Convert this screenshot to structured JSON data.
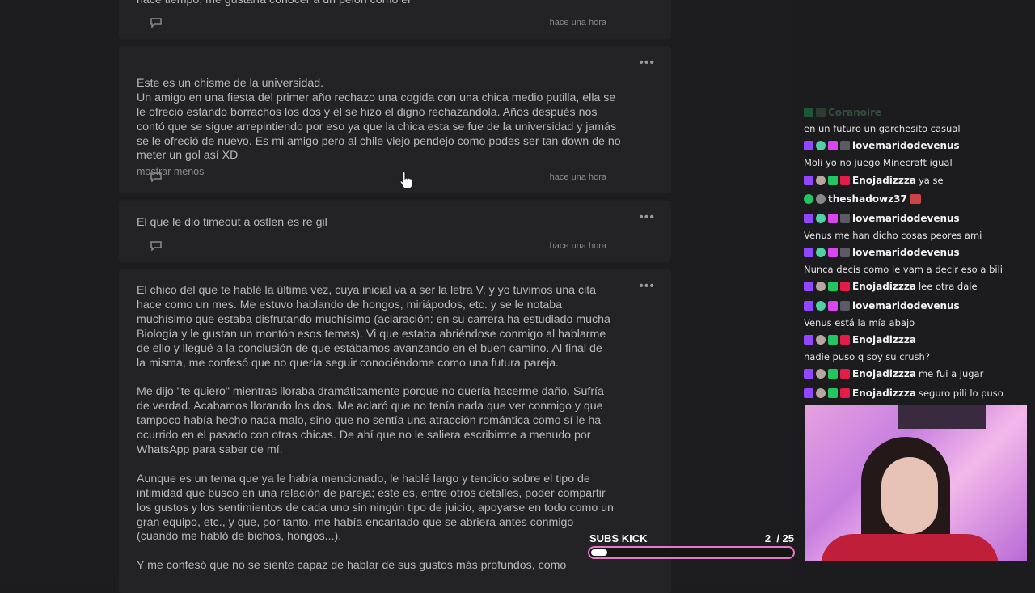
{
  "posts": [
    {
      "text": "hace tiempo, me gustaría conocer a un pelón como él",
      "time": "hace una hora"
    },
    {
      "text": "Este es un chisme de la universidad.\nUn amigo en una fiesta del primer año rechazo una cogida con una chica medio putilla, ella se le ofreció estando borrachos los dos y él se hizo el digno rechazandola. Años después nos contó que se sigue arrepintiendo por eso ya que la chica esta se fue de la universidad y jamás se le ofreció de nuevo. Es mi amigo pero al chile viejo pendejo como podes ser tan down de no meter un gol así XD",
      "toggle": "mostrar menos",
      "time": "hace una hora",
      "more": "•••"
    },
    {
      "text": "El que le dio timeout a ostlen es re gil",
      "time": "hace una hora",
      "more": "•••"
    },
    {
      "text": "El chico del que te hablé la última vez, cuya inicial va a ser la letra V, y yo tuvimos una cita hace como un mes. Me estuvo hablando de hongos, miriápodos, etc. y se le notaba muchísimo que estaba disfrutando muchísimo (aclaración: en su carrera ha estudiado mucha Biología y le gustan un montón esos temas). Vi que estaba abriéndose conmigo al hablarme de ello y llegué a la conclusión de que estábamos avanzando en el buen camino. Al final de la misma, me confesó que no quería seguir conociéndome como una futura pareja.\n\nMe dijo \"te quiero\" mientras lloraba dramáticamente porque no quería hacerme daño. Sufría de verdad. Acabamos llorando los dos. Me aclaró que no tenía nada que ver conmigo y que tampoco había hecho nada malo, sino que no sentía una atracción romántica como sí le ha ocurrido en el pasado con otras chicas. De ahí que no le saliera escribirme a menudo por WhatsApp para saber de mí.\n\nAunque es un tema que ya le había mencionado, le hablé largo y tendido sobre el tipo de intimidad que busco en una relación de pareja; este es, entre otros detalles, poder compartir los gustos y los sentimientos de cada uno sin ningún tipo de juicio, apoyarse en todo como un gran equipo, etc., y que, por tanto, me había encantado que se abriera antes conmigo (cuando me habló de bichos, hongos...).\n\nY me confesó que no se siente capaz de hablar de sus gustos más profundos, como",
      "more": "•••"
    }
  ],
  "chat": [
    {
      "user": "Coranoire",
      "msg": ""
    },
    {
      "user": "",
      "msg": "en un futuro un garchesito casual"
    },
    {
      "user": "lovemaridodevenus",
      "msg": ""
    },
    {
      "user": "",
      "msg": "Moli yo no juego Minecraft igual"
    },
    {
      "user": "Enojadizzza",
      "msg": "ya se"
    },
    {
      "user": "theshadowz37",
      "msg": ""
    },
    {
      "user": "lovemaridodevenus",
      "msg": ""
    },
    {
      "user": "",
      "msg": "Venus me han dicho cosas peores ami"
    },
    {
      "user": "lovemaridodevenus",
      "msg": ""
    },
    {
      "user": "",
      "msg": "Nunca decís como le vam a decir eso a bili"
    },
    {
      "user": "Enojadizzza",
      "msg": "lee otra dale"
    },
    {
      "user": "lovemaridodevenus",
      "msg": ""
    },
    {
      "user": "",
      "msg": "Venus está la mía abajo"
    },
    {
      "user": "Enojadizzza",
      "msg": ""
    },
    {
      "user": "",
      "msg": "nadie puso q soy su crush?"
    },
    {
      "user": "Enojadizzza",
      "msg": "me fui a jugar"
    },
    {
      "user": "Enojadizzza",
      "msg": "seguro pili lo puso"
    }
  ],
  "subs": {
    "label": "SUBS KICK",
    "count": "2",
    "goal": "/ 25",
    "progress": 0.08
  },
  "colors": {
    "accent": "#e879c9",
    "twitch": "#9146ff"
  }
}
